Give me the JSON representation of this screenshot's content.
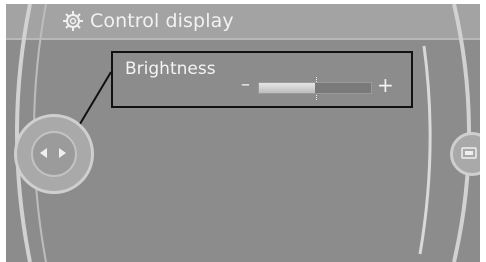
{
  "header": {
    "title": "Control display",
    "icon": "gear-icon"
  },
  "brightness": {
    "label": "Brightness",
    "minus": "–",
    "plus": "+",
    "level": 0.5
  },
  "controller": {
    "left_icon": "arrow-left-icon",
    "right_icon": "arrow-right-icon",
    "side_icon": "display-icon"
  }
}
